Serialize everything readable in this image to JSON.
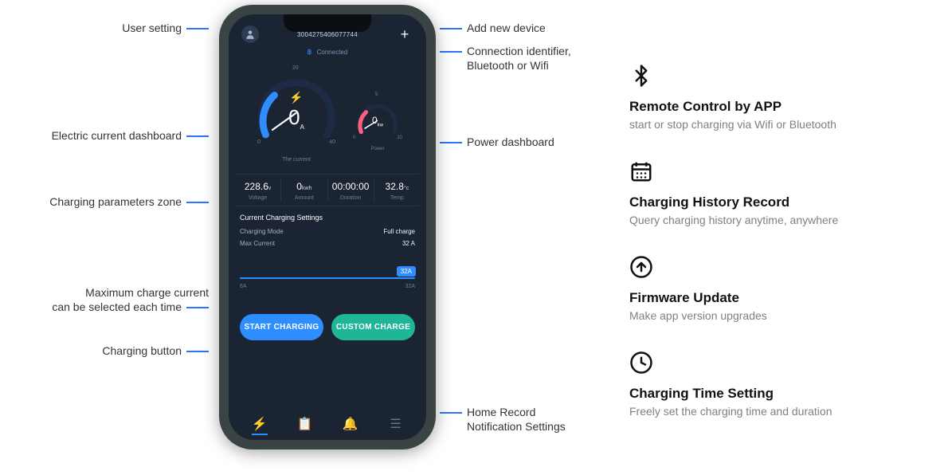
{
  "callouts_left": {
    "user_setting": "User setting",
    "current_dash": "Electric current dashboard",
    "params_zone": "Charging parameters zone",
    "max_current_line1": "Maximum charge current",
    "max_current_line2": "can be selected each time",
    "charging_button": "Charging button"
  },
  "callouts_right": {
    "add_device": "Add new device",
    "conn_id_line1": "Connection identifier,",
    "conn_id_line2": "Bluetooth or Wifi",
    "power_dash": "Power dashboard",
    "bottom_nav_line1": "Home  Record",
    "bottom_nav_line2": "Notification  Settings"
  },
  "phone": {
    "device_id": "3004275406077744",
    "connected_label": "Connected",
    "gauge_current": {
      "value": "0",
      "unit": "A",
      "tick0": "0",
      "tick1": "20",
      "tick2": "40",
      "caption": "The current"
    },
    "gauge_power": {
      "value": "0",
      "unit": "kw",
      "tick0": "0",
      "tick1": "5",
      "tick2": "10",
      "caption": "Power"
    },
    "params": {
      "voltage_v": "228.6",
      "voltage_u": "v",
      "voltage_l": "Voltage",
      "amount_v": "0",
      "amount_u": "kwh",
      "amount_l": "Amount",
      "duration_v": "00:00:00",
      "duration_u": "",
      "duration_l": "Duration",
      "temp_v": "32.8",
      "temp_u": "°c",
      "temp_l": "Temp"
    },
    "settings": {
      "title": "Current Charging Settings",
      "mode_label": "Charging Mode",
      "mode_value": "Full charge",
      "max_label": "Max Current",
      "max_value": "32 A"
    },
    "slider": {
      "bubble": "32A",
      "min": "6A",
      "max": "32A"
    },
    "buttons": {
      "start": "START CHARGING",
      "custom": "CUSTOM CHARGE"
    }
  },
  "features": {
    "f1_title": "Remote Control by APP",
    "f1_desc": "start or stop charging via Wifi or Bluetooth",
    "f2_title": "Charging History Record",
    "f2_desc": "Query charging history anytime, anywhere",
    "f3_title": "Firmware Update",
    "f3_desc": "Make app version upgrades",
    "f4_title": "Charging Time Setting",
    "f4_desc": "Freely set the charging time and duration"
  }
}
